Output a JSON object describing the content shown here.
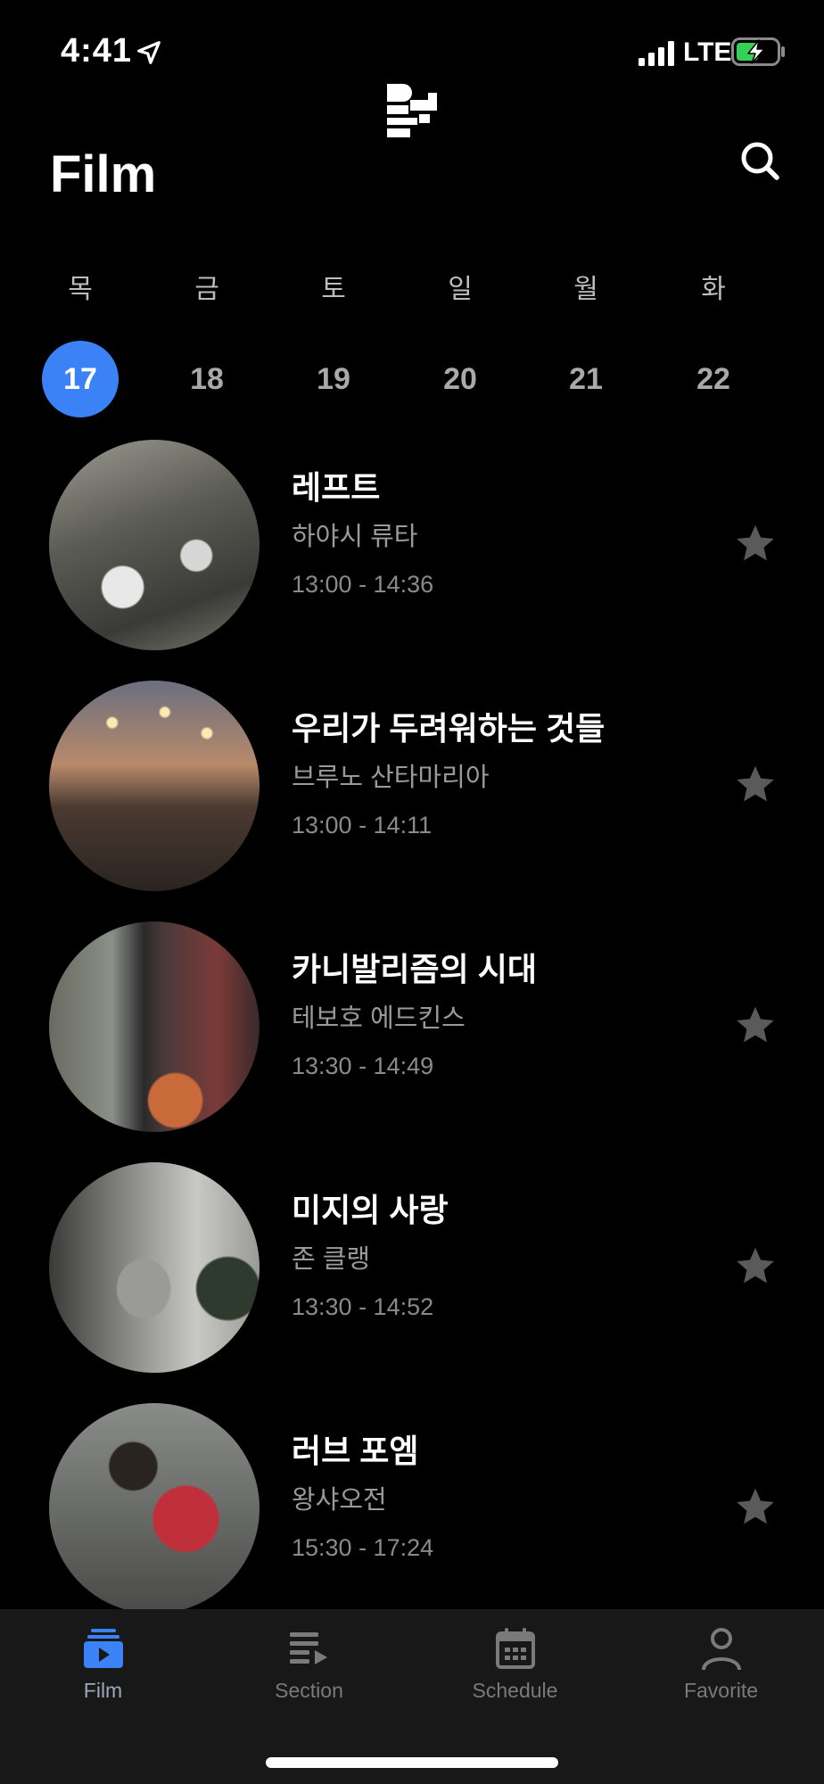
{
  "status_bar": {
    "time": "4:41",
    "network": "LTE"
  },
  "header": {
    "title": "Film"
  },
  "dates": [
    {
      "weekday": "목",
      "day": "17",
      "selected": true
    },
    {
      "weekday": "금",
      "day": "18",
      "selected": false
    },
    {
      "weekday": "토",
      "day": "19",
      "selected": false
    },
    {
      "weekday": "일",
      "day": "20",
      "selected": false
    },
    {
      "weekday": "월",
      "day": "21",
      "selected": false
    },
    {
      "weekday": "화",
      "day": "22",
      "selected": false
    }
  ],
  "films": [
    {
      "title": "레프트",
      "director": "하야시 류타",
      "time": "13:00 - 14:36"
    },
    {
      "title": "우리가 두려워하는 것들",
      "director": "브루노 산타마리아",
      "time": "13:00 - 14:11"
    },
    {
      "title": "카니발리즘의 시대",
      "director": "테보호 에드킨스",
      "time": "13:30 - 14:49"
    },
    {
      "title": "미지의 사랑",
      "director": "존 클랭",
      "time": "13:30 - 14:52"
    },
    {
      "title": "러브 포엠",
      "director": "왕샤오전",
      "time": "15:30 - 17:24"
    }
  ],
  "tabs": [
    {
      "label": "Film",
      "icon": "film-icon",
      "active": true
    },
    {
      "label": "Section",
      "icon": "section-icon",
      "active": false
    },
    {
      "label": "Schedule",
      "icon": "calendar-icon",
      "active": false
    },
    {
      "label": "Favorite",
      "icon": "person-icon",
      "active": false
    }
  ],
  "colors": {
    "accent": "#3b82f6",
    "background": "#000000",
    "tab_bar": "#181818",
    "star": "#5a5a5a"
  }
}
